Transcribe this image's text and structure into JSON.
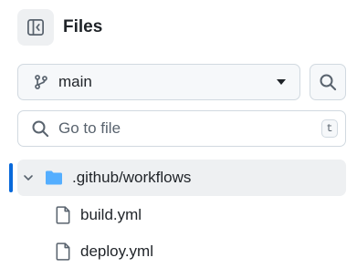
{
  "sidebar": {
    "title": "Files",
    "branch": {
      "label": "main"
    },
    "goto_file": {
      "placeholder": "Go to file",
      "shortcut": "t"
    },
    "tree": [
      {
        "type": "folder",
        "label": ".github/workflows",
        "expanded": true,
        "active": true
      },
      {
        "type": "file",
        "label": "build.yml"
      },
      {
        "type": "file",
        "label": "deploy.yml"
      }
    ]
  },
  "icons": {
    "collapse": "sidebar-collapse-icon",
    "branch": "git-branch-icon",
    "dropdown": "triangle-down-icon",
    "search": "search-icon",
    "chevron": "chevron-down-icon",
    "folder": "folder-icon",
    "file": "file-icon"
  },
  "colors": {
    "accent": "#0969da",
    "folder": "#54aeff",
    "active_row_bg": "#eef0f2",
    "border": "#d1d9e0"
  }
}
